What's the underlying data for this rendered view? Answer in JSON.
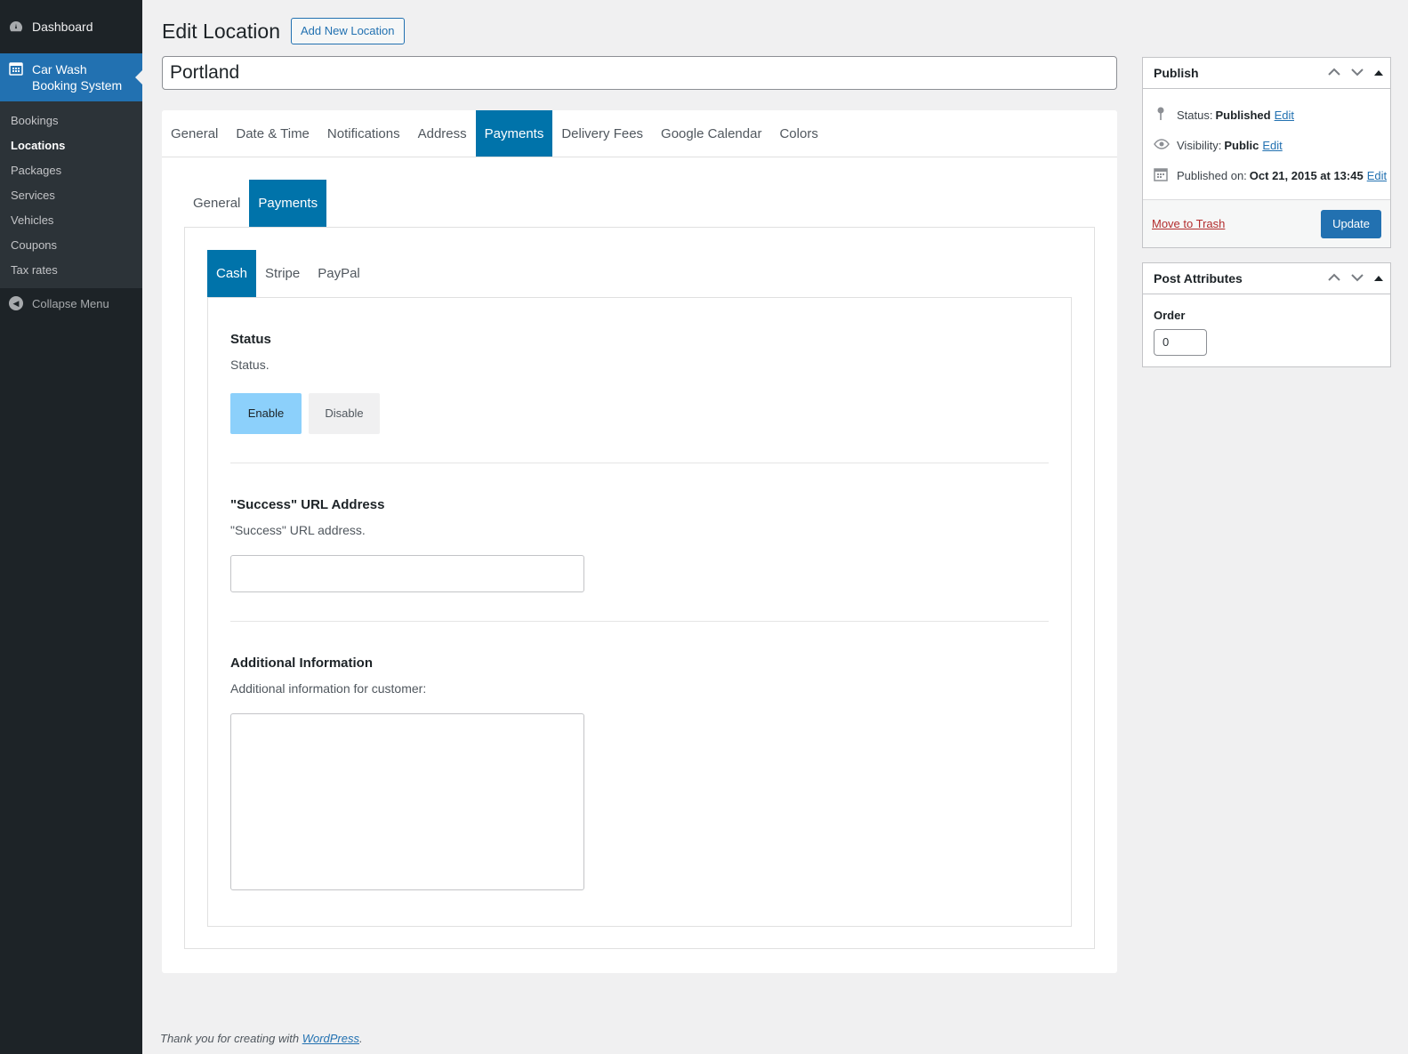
{
  "sidebar": {
    "dashboard_label": "Dashboard",
    "active_label_line1": "Car Wash",
    "active_label_line2": "Booking System",
    "items": [
      {
        "label": "Bookings"
      },
      {
        "label": "Locations"
      },
      {
        "label": "Packages"
      },
      {
        "label": "Services"
      },
      {
        "label": "Vehicles"
      },
      {
        "label": "Coupons"
      },
      {
        "label": "Tax rates"
      }
    ],
    "current_item": "Locations",
    "collapse_label": "Collapse Menu"
  },
  "header": {
    "title": "Edit Location",
    "add_new_label": "Add New Location"
  },
  "post_title": "Portland",
  "main_tabs": [
    {
      "label": "General"
    },
    {
      "label": "Date & Time"
    },
    {
      "label": "Notifications"
    },
    {
      "label": "Address"
    },
    {
      "label": "Payments"
    },
    {
      "label": "Delivery Fees"
    },
    {
      "label": "Google Calendar"
    },
    {
      "label": "Colors"
    }
  ],
  "main_tabs_active": "Payments",
  "sub_tabs": [
    {
      "label": "General"
    },
    {
      "label": "Payments"
    }
  ],
  "sub_tabs_active": "Payments",
  "method_tabs": [
    {
      "label": "Cash"
    },
    {
      "label": "Stripe"
    },
    {
      "label": "PayPal"
    }
  ],
  "method_tabs_active": "Cash",
  "status_section": {
    "title": "Status",
    "description": "Status.",
    "enable_label": "Enable",
    "disable_label": "Disable",
    "selected": "Enable"
  },
  "success_url_section": {
    "title": "\"Success\" URL Address",
    "description": "\"Success\" URL address.",
    "value": ""
  },
  "additional_info_section": {
    "title": "Additional Information",
    "description": "Additional information for customer:",
    "value": ""
  },
  "publish_box": {
    "title": "Publish",
    "status_label": "Status:",
    "status_value": "Published",
    "visibility_label": "Visibility:",
    "visibility_value": "Public",
    "published_on_label": "Published on:",
    "published_on_value": "Oct 21, 2015 at 13:45",
    "edit_label": "Edit",
    "trash_label": "Move to Trash",
    "update_label": "Update"
  },
  "attributes_box": {
    "title": "Post Attributes",
    "order_label": "Order",
    "order_value": "0"
  },
  "footer": {
    "text": "Thank you for creating with",
    "link": "WordPress",
    "period": "."
  },
  "colors": {
    "admin_blue": "#2271b1",
    "tab_active": "#0073aa",
    "sidebar_bg": "#1d2327",
    "enable_selected": "#8cd0fb"
  },
  "icons": {
    "dashboard": "dashboard-icon",
    "calendar": "calendar-icon",
    "collapse": "collapse-icon",
    "pin": "pin-icon",
    "eye": "eye-icon",
    "date": "calendar-icon"
  }
}
